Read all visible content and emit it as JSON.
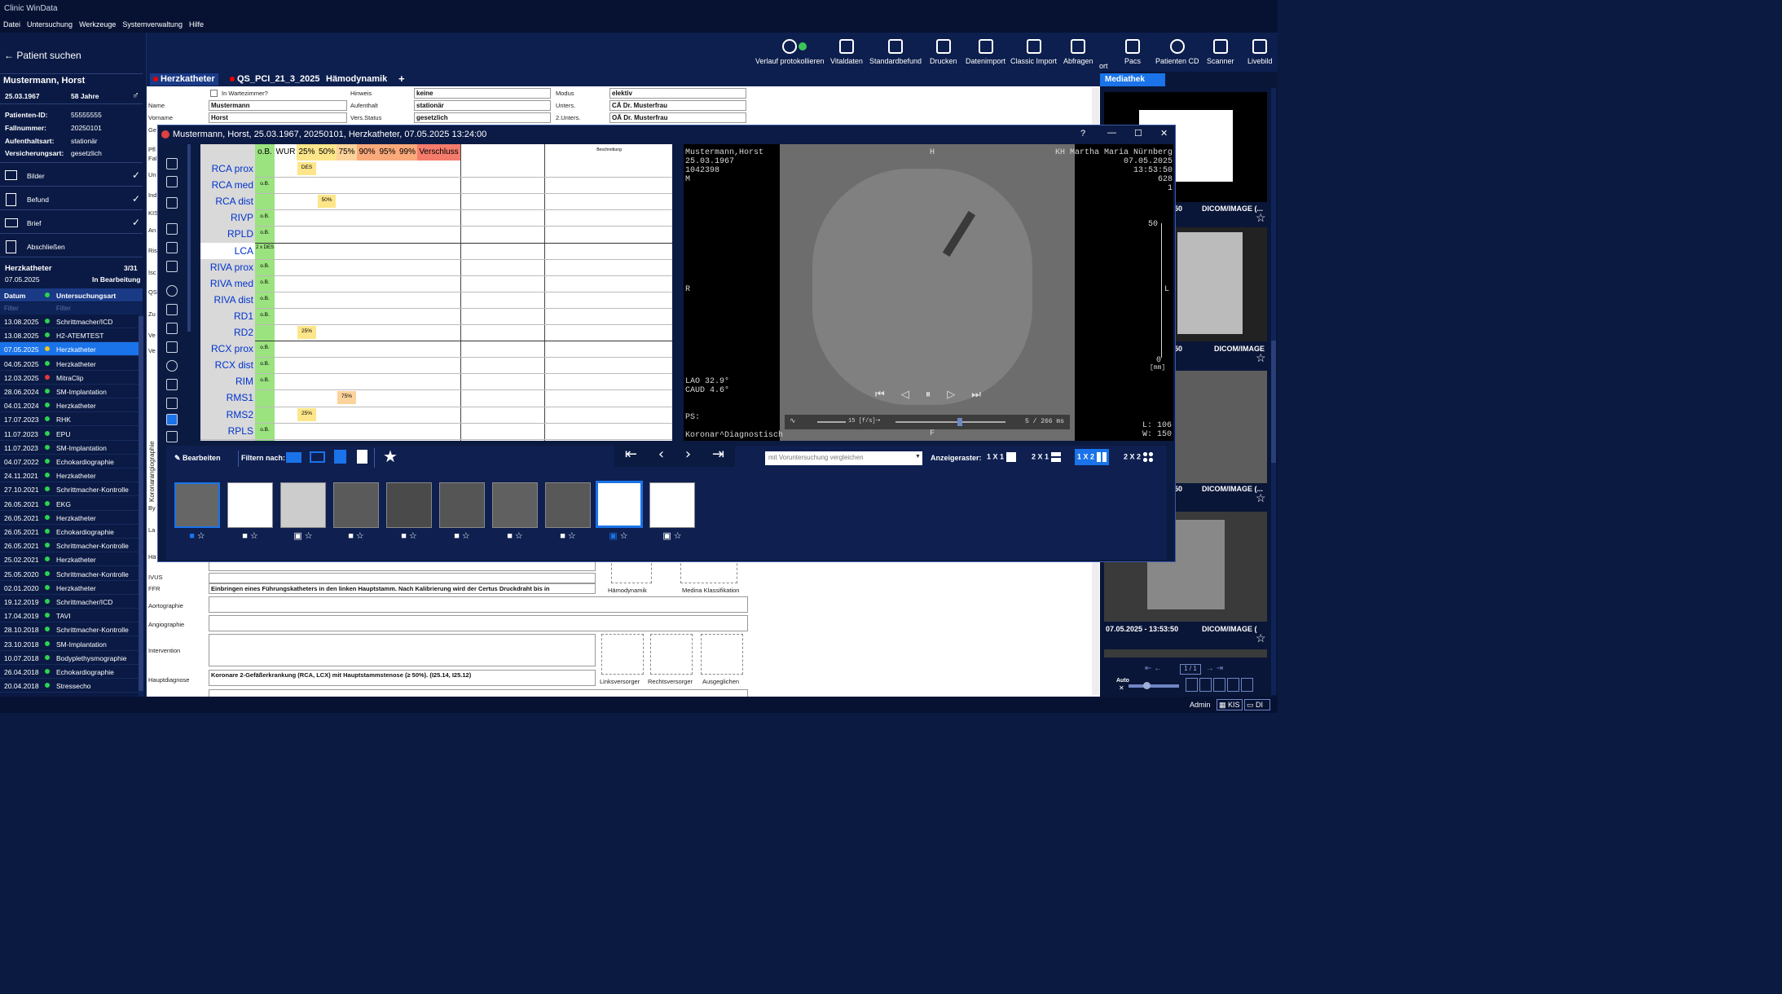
{
  "app_title": "Clinic WinData",
  "menu": [
    "Datei",
    "Untersuchung",
    "Werkzeuge",
    "Systemverwaltung",
    "Hilfe"
  ],
  "left": {
    "back_label": "Patient suchen",
    "patient_name": "Mustermann, Horst",
    "dob": "25.03.1967",
    "age": "58 Jahre",
    "info": [
      [
        "Patienten-ID:",
        "55555555"
      ],
      [
        "Fallnummer:",
        "20250101"
      ],
      [
        "Aufenthaltsart:",
        "stationär"
      ],
      [
        "Versicherungsart:",
        "gesetzlich"
      ]
    ],
    "actions": [
      "Bilder",
      "Befund",
      "Brief",
      "Abschließen"
    ],
    "exam_title": "Herzkatheter",
    "exam_count": "3/31",
    "exam_date": "07.05.2025",
    "exam_status": "In Bearbeitung",
    "col_date": "Datum",
    "col_type": "Untersuchungsart",
    "filter": "Filter",
    "rows": [
      [
        "13.08.2025",
        "Schrittmacher/ICD",
        "green"
      ],
      [
        "13.08.2025",
        "H2-ATEMTEST",
        "green"
      ],
      [
        "07.05.2025",
        "Herzkatheter",
        "yellow"
      ],
      [
        "04.05.2025",
        "Herzkatheter",
        "green"
      ],
      [
        "12.03.2025",
        "MitraClip",
        "red"
      ],
      [
        "28.06.2024",
        "SM-Implantation",
        "green"
      ],
      [
        "04.01.2024",
        "Herzkatheter",
        "green"
      ],
      [
        "17.07.2023",
        "RHK",
        "green"
      ],
      [
        "11.07.2023",
        "EPU",
        "green"
      ],
      [
        "11.07.2023",
        "SM-Implantation",
        "green"
      ],
      [
        "04.07.2022",
        "Echokardiographie",
        "green"
      ],
      [
        "24.11.2021",
        "Herzkatheter",
        "green"
      ],
      [
        "27.10.2021",
        "Schrittmacher-Kontrolle",
        "green"
      ],
      [
        "26.05.2021",
        "EKG",
        "green"
      ],
      [
        "26.05.2021",
        "Herzkatheter",
        "green"
      ],
      [
        "26.05.2021",
        "Echokardiographie",
        "green"
      ],
      [
        "26.05.2021",
        "Schrittmacher-Kontrolle",
        "green"
      ],
      [
        "25.02.2021",
        "Herzkatheter",
        "green"
      ],
      [
        "25.05.2020",
        "Schrittmacher-Kontrolle",
        "green"
      ],
      [
        "02.01.2020",
        "Herzkatheter",
        "green"
      ],
      [
        "19.12.2019",
        "Schrittmacher/ICD",
        "green"
      ],
      [
        "17.04.2019",
        "TAVI",
        "green"
      ],
      [
        "28.10.2018",
        "Schrittmacher-Kontrolle",
        "green"
      ],
      [
        "23.10.2018",
        "SM-Implantation",
        "green"
      ],
      [
        "10.07.2018",
        "Bodyplethysmographie",
        "green"
      ],
      [
        "26.04.2018",
        "Echokardiographie",
        "green"
      ],
      [
        "20.04.2018",
        "Stressecho",
        "green"
      ]
    ]
  },
  "toolbar": [
    "Verlauf protokollieren",
    "Vitaldaten",
    "Standardbefund",
    "Drucken",
    "Datenimport",
    "Classic Import",
    "Abfragen",
    "ort",
    "Pacs",
    "Patienten CD",
    "Scanner",
    "Livebild"
  ],
  "tabs": [
    "Herzkatheter",
    "QS_PCI_21_3_2025",
    "Hämodynamik",
    "+"
  ],
  "form": {
    "waiting": "In Wartezimmer?",
    "labels": [
      "Name",
      "Vorname",
      "Hinweis",
      "Aufenthalt",
      "Vers.Status",
      "Modus",
      "Unters.",
      "2.Unters."
    ],
    "values": [
      "Mustermann",
      "Horst",
      "keine",
      "stationär",
      "gesetzlich",
      "elektiv",
      "CÄ Dr. Musterfrau",
      "OÄ Dr. Musterfrau"
    ],
    "lower_labels": [
      "IVUS",
      "FFR",
      "Aortographie",
      "Angiographie",
      "Intervention",
      "Hauptdiagnose"
    ],
    "ffr_text": "Einbringen eines Führungskatheters in den linken Hauptstamm. Nach Kalibrierung wird der Certus Druckdraht bis in",
    "diag_text": "Koronare 2-Gefäßerkrankung (RCA, LCX) mit  Hauptstammstenose (≥ 50%). (I25.14, I25.12)",
    "img_labels": [
      "Hämodynamik",
      "Medina Klassifikation",
      "Linksversorger",
      "Rechtsversorger",
      "Ausgeglichen"
    ],
    "side_short": [
      "Ge",
      "Pfl",
      "Fal",
      "Un",
      "Ind",
      "KIS",
      "An",
      "Ris",
      "Isc",
      "QS",
      "Zu",
      "Ve",
      "Ve",
      "By",
      "La",
      "Hä"
    ],
    "vertical": "Koronarangiographie"
  },
  "window": {
    "title": "Mustermann, Horst, 25.03.1967, 20250101, Herzkatheter, 07.05.2025 13:24:00",
    "headers": [
      "o.B.",
      "WUR",
      "25%",
      "50%",
      "75%",
      "90%",
      "95%",
      "99%",
      "Verschluss"
    ],
    "header_right": "Beschreibung",
    "vessels": [
      [
        "RCA prox",
        "",
        "DES"
      ],
      [
        "RCA med",
        "o.B.",
        ""
      ],
      [
        "RCA dist",
        "",
        "50%"
      ],
      [
        "RIVP",
        "o.B.",
        ""
      ],
      [
        "RPLD",
        "o.B.",
        ""
      ],
      [
        "LCA",
        "2 x DES",
        ""
      ],
      [
        "RIVA prox",
        "o.B.",
        ""
      ],
      [
        "RIVA med",
        "o.B.",
        ""
      ],
      [
        "RIVA dist",
        "o.B.",
        ""
      ],
      [
        "RD1",
        "o.B.",
        ""
      ],
      [
        "RD2",
        "",
        "25%"
      ],
      [
        "RCX prox",
        "o.B.",
        ""
      ],
      [
        "RCX dist",
        "o.B.",
        ""
      ],
      [
        "RIM",
        "o.B.",
        ""
      ],
      [
        "RMS1",
        "",
        "75%"
      ],
      [
        "RMS2",
        "",
        "25%"
      ],
      [
        "RPLS",
        "o.B.",
        ""
      ]
    ],
    "dicom_left": [
      "Mustermann,Horst",
      "25.03.1967",
      "1042398",
      "M"
    ],
    "dicom_right": [
      "KH Martha Maria Nürnberg",
      "07.05.2025",
      "13:53:50",
      "628",
      "1"
    ],
    "dicom_H": "H",
    "dicom_R": "R",
    "dicom_L": "L",
    "dicom_F": "F",
    "dicom_angle": [
      "LAO 32.9°",
      "CAUD 4.6°"
    ],
    "dicom_ps": "PS:",
    "dicom_study": "Koronar^Diagnostisch",
    "dicom_lw": [
      "L: 106",
      "W: 150"
    ],
    "scale_top": "50",
    "scale_bottom": "0",
    "scale_unit": "[mm]",
    "fps": "15 [f/s]",
    "frame": "5 / 266 ms",
    "edit": "Bearbeiten",
    "filter": "Filtern nach:",
    "compare": "mit Voruntersuchung vergleichen",
    "raster": "Anzeigeraster:",
    "grids": [
      "1 X 1",
      "2 X 1",
      "1 X 2",
      "2 X 2"
    ]
  },
  "mediathek": {
    "title": "Mediathek",
    "items": [
      "DICOM/IMAGE (...",
      "DICOM/IMAGE",
      "DICOM/IMAGE (...",
      "DICOM/IMAGE ("
    ],
    "last_date": "07.05.2025 - 13:53:50",
    "page": "1 / 1",
    "auto": "Auto"
  },
  "status": {
    "user": "Admin",
    "kis": "KIS",
    "di": "DI"
  }
}
